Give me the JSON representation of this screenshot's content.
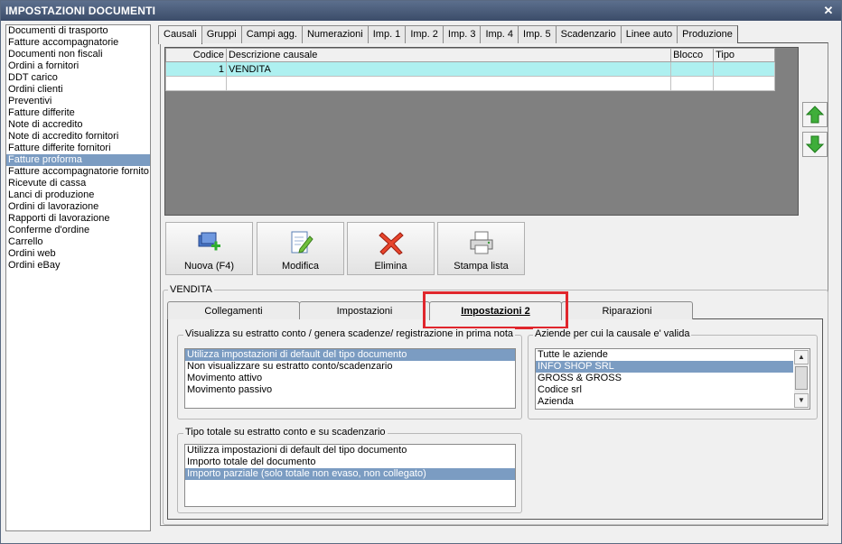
{
  "window": {
    "title": "IMPOSTAZIONI DOCUMENTI",
    "close_glyph": "✕"
  },
  "doc_types": [
    "Documenti di trasporto",
    "Fatture accompagnatorie",
    "Documenti non fiscali",
    "Ordini a fornitori",
    "DDT carico",
    "Ordini clienti",
    "Preventivi",
    "Fatture differite",
    "Note di accredito",
    "Note di accredito fornitori",
    "Fatture differite fornitori",
    "Fatture proforma",
    "Fatture accompagnatorie fornito",
    "Ricevute di cassa",
    "Lanci di produzione",
    "Ordini di lavorazione",
    "Rapporti di lavorazione",
    "Conferme d'ordine",
    "Carrello",
    "Ordini web",
    "Ordini eBay"
  ],
  "doc_types_selected": "Fatture proforma",
  "top_tabs": [
    "Causali",
    "Gruppi",
    "Campi agg.",
    "Numerazioni",
    "Imp. 1",
    "Imp. 2",
    "Imp. 3",
    "Imp. 4",
    "Imp. 5",
    "Scadenzario",
    "Linee auto",
    "Produzione"
  ],
  "top_tab_active": "Causali",
  "grid": {
    "headers": {
      "codice": "Codice",
      "descrizione": "Descrizione causale",
      "blocco": "Blocco",
      "tipo": "Tipo"
    },
    "rows": [
      {
        "codice": "1",
        "descrizione": "VENDITA",
        "blocco": "",
        "tipo": ""
      },
      {
        "codice": "",
        "descrizione": "",
        "blocco": "",
        "tipo": ""
      }
    ]
  },
  "move_icons": {
    "up": "arrow-up-icon",
    "down": "arrow-down-icon"
  },
  "actions": {
    "nuova": "Nuova (F4)",
    "modifica": "Modifica",
    "elimina": "Elimina",
    "stampa": "Stampa lista"
  },
  "section_title": "VENDITA",
  "sub_tabs": {
    "collegamenti": "Collegamenti",
    "impostazioni": "Impostazioni",
    "impostazioni2": "Impostazioni 2",
    "riparazioni": "Riparazioni"
  },
  "sub_tab_active": "Impostazioni 2",
  "visualizza": {
    "title": "Visualizza su estratto conto / genera scadenze/ registrazione  in prima nota",
    "options": [
      "Utilizza impostazioni di default del tipo documento",
      "Non visualizzare su estratto conto/scadenzario",
      "Movimento attivo",
      "Movimento passivo"
    ],
    "selected": "Utilizza impostazioni di default del tipo documento"
  },
  "aziende": {
    "title": "Aziende per cui la causale e' valida",
    "options": [
      "Tutte le aziende",
      "INFO SHOP SRL",
      "GROSS & GROSS",
      "Codice srl",
      "Azienda"
    ],
    "selected": "INFO SHOP SRL",
    "scroll_up": "▲",
    "scroll_down": "▼"
  },
  "tipo_totale": {
    "title": "Tipo totale su estratto conto e su scadenzario",
    "options": [
      "Utilizza impostazioni di default del tipo documento",
      "Importo totale del documento",
      "Importo parziale (solo totale non evaso, non collegato)"
    ],
    "selected": "Importo parziale (solo totale non evaso, non collegato)"
  },
  "colors": {
    "title_bar": "#3b4c69",
    "selection": "#7b9cc2",
    "grid_selection": "#aef0f0",
    "highlight": "#e0262c",
    "arrow_green": "#3fae3a"
  }
}
